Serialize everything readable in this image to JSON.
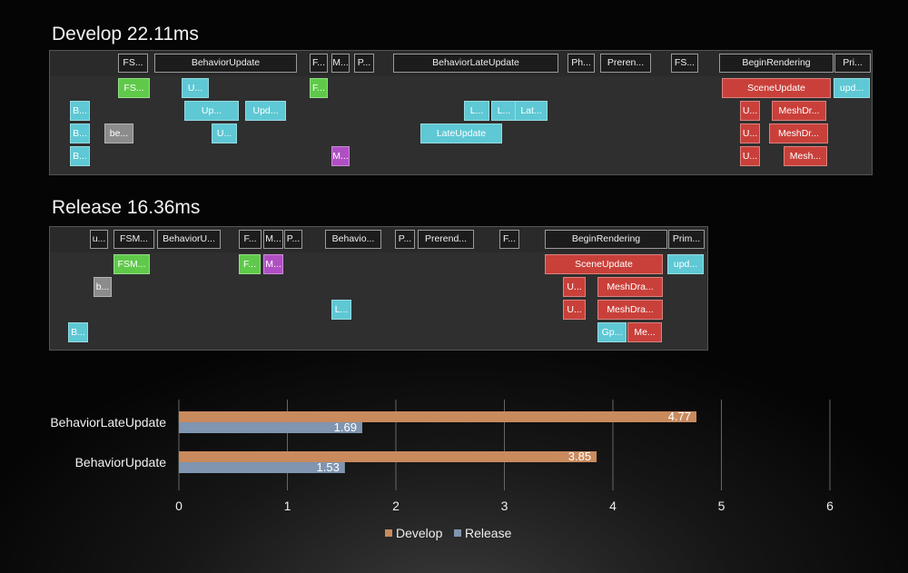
{
  "develop": {
    "title": "Develop 22.11ms",
    "headers": [
      {
        "label": "FS...",
        "color": "gray"
      },
      {
        "label": "BehaviorUpdate",
        "color": "gray"
      },
      {
        "label": "F...",
        "color": "gray"
      },
      {
        "label": "M...",
        "color": "gray"
      },
      {
        "label": "P...",
        "color": "gray"
      },
      {
        "label": "BehaviorLateUpdate",
        "color": "gray"
      },
      {
        "label": "Ph...",
        "color": "gray"
      },
      {
        "label": "Preren...",
        "color": "gray"
      },
      {
        "label": "FS...",
        "color": "gray"
      },
      {
        "label": "BeginRendering",
        "color": "gray"
      },
      {
        "label": "Pri...",
        "color": "gray"
      }
    ],
    "labels": [
      "FS...",
      "U...",
      "F...",
      "SceneUpdate",
      "upd...",
      "B...",
      "Up...",
      "Upd...",
      "L...",
      "L...",
      "Lat...",
      "U...",
      "MeshDr...",
      "B...",
      "be...",
      "U...",
      "LateUpdate",
      "U...",
      "MeshDr...",
      "B...",
      "M...",
      "U...",
      "Mesh..."
    ]
  },
  "release": {
    "title": "Release 16.36ms",
    "headers": [
      "u...",
      "FSM...",
      "BehaviorU...",
      "F...",
      "M...",
      "P...",
      "Behavio...",
      "P...",
      "Prerend...",
      "F...",
      "BeginRendering",
      "Prim..."
    ],
    "labels": [
      "FSM...",
      "F...",
      "M...",
      "SceneUpdate",
      "upd...",
      "b...",
      "U...",
      "MeshDra...",
      "L...",
      "U...",
      "MeshDra...",
      "B...",
      "Gp...",
      "Me..."
    ]
  },
  "chart_data": {
    "type": "bar",
    "orientation": "horizontal",
    "categories": [
      "BehaviorLateUpdate",
      "BehaviorUpdate"
    ],
    "series": [
      {
        "name": "Develop",
        "values": [
          4.77,
          3.85
        ],
        "color": "#c98a5e"
      },
      {
        "name": "Release",
        "values": [
          1.69,
          1.53
        ],
        "color": "#7f95b0"
      }
    ],
    "ticks": [
      "0",
      "1",
      "2",
      "3",
      "4",
      "5",
      "6"
    ],
    "xlim": [
      0,
      6
    ],
    "grid": true,
    "legend_position": "bottom"
  }
}
